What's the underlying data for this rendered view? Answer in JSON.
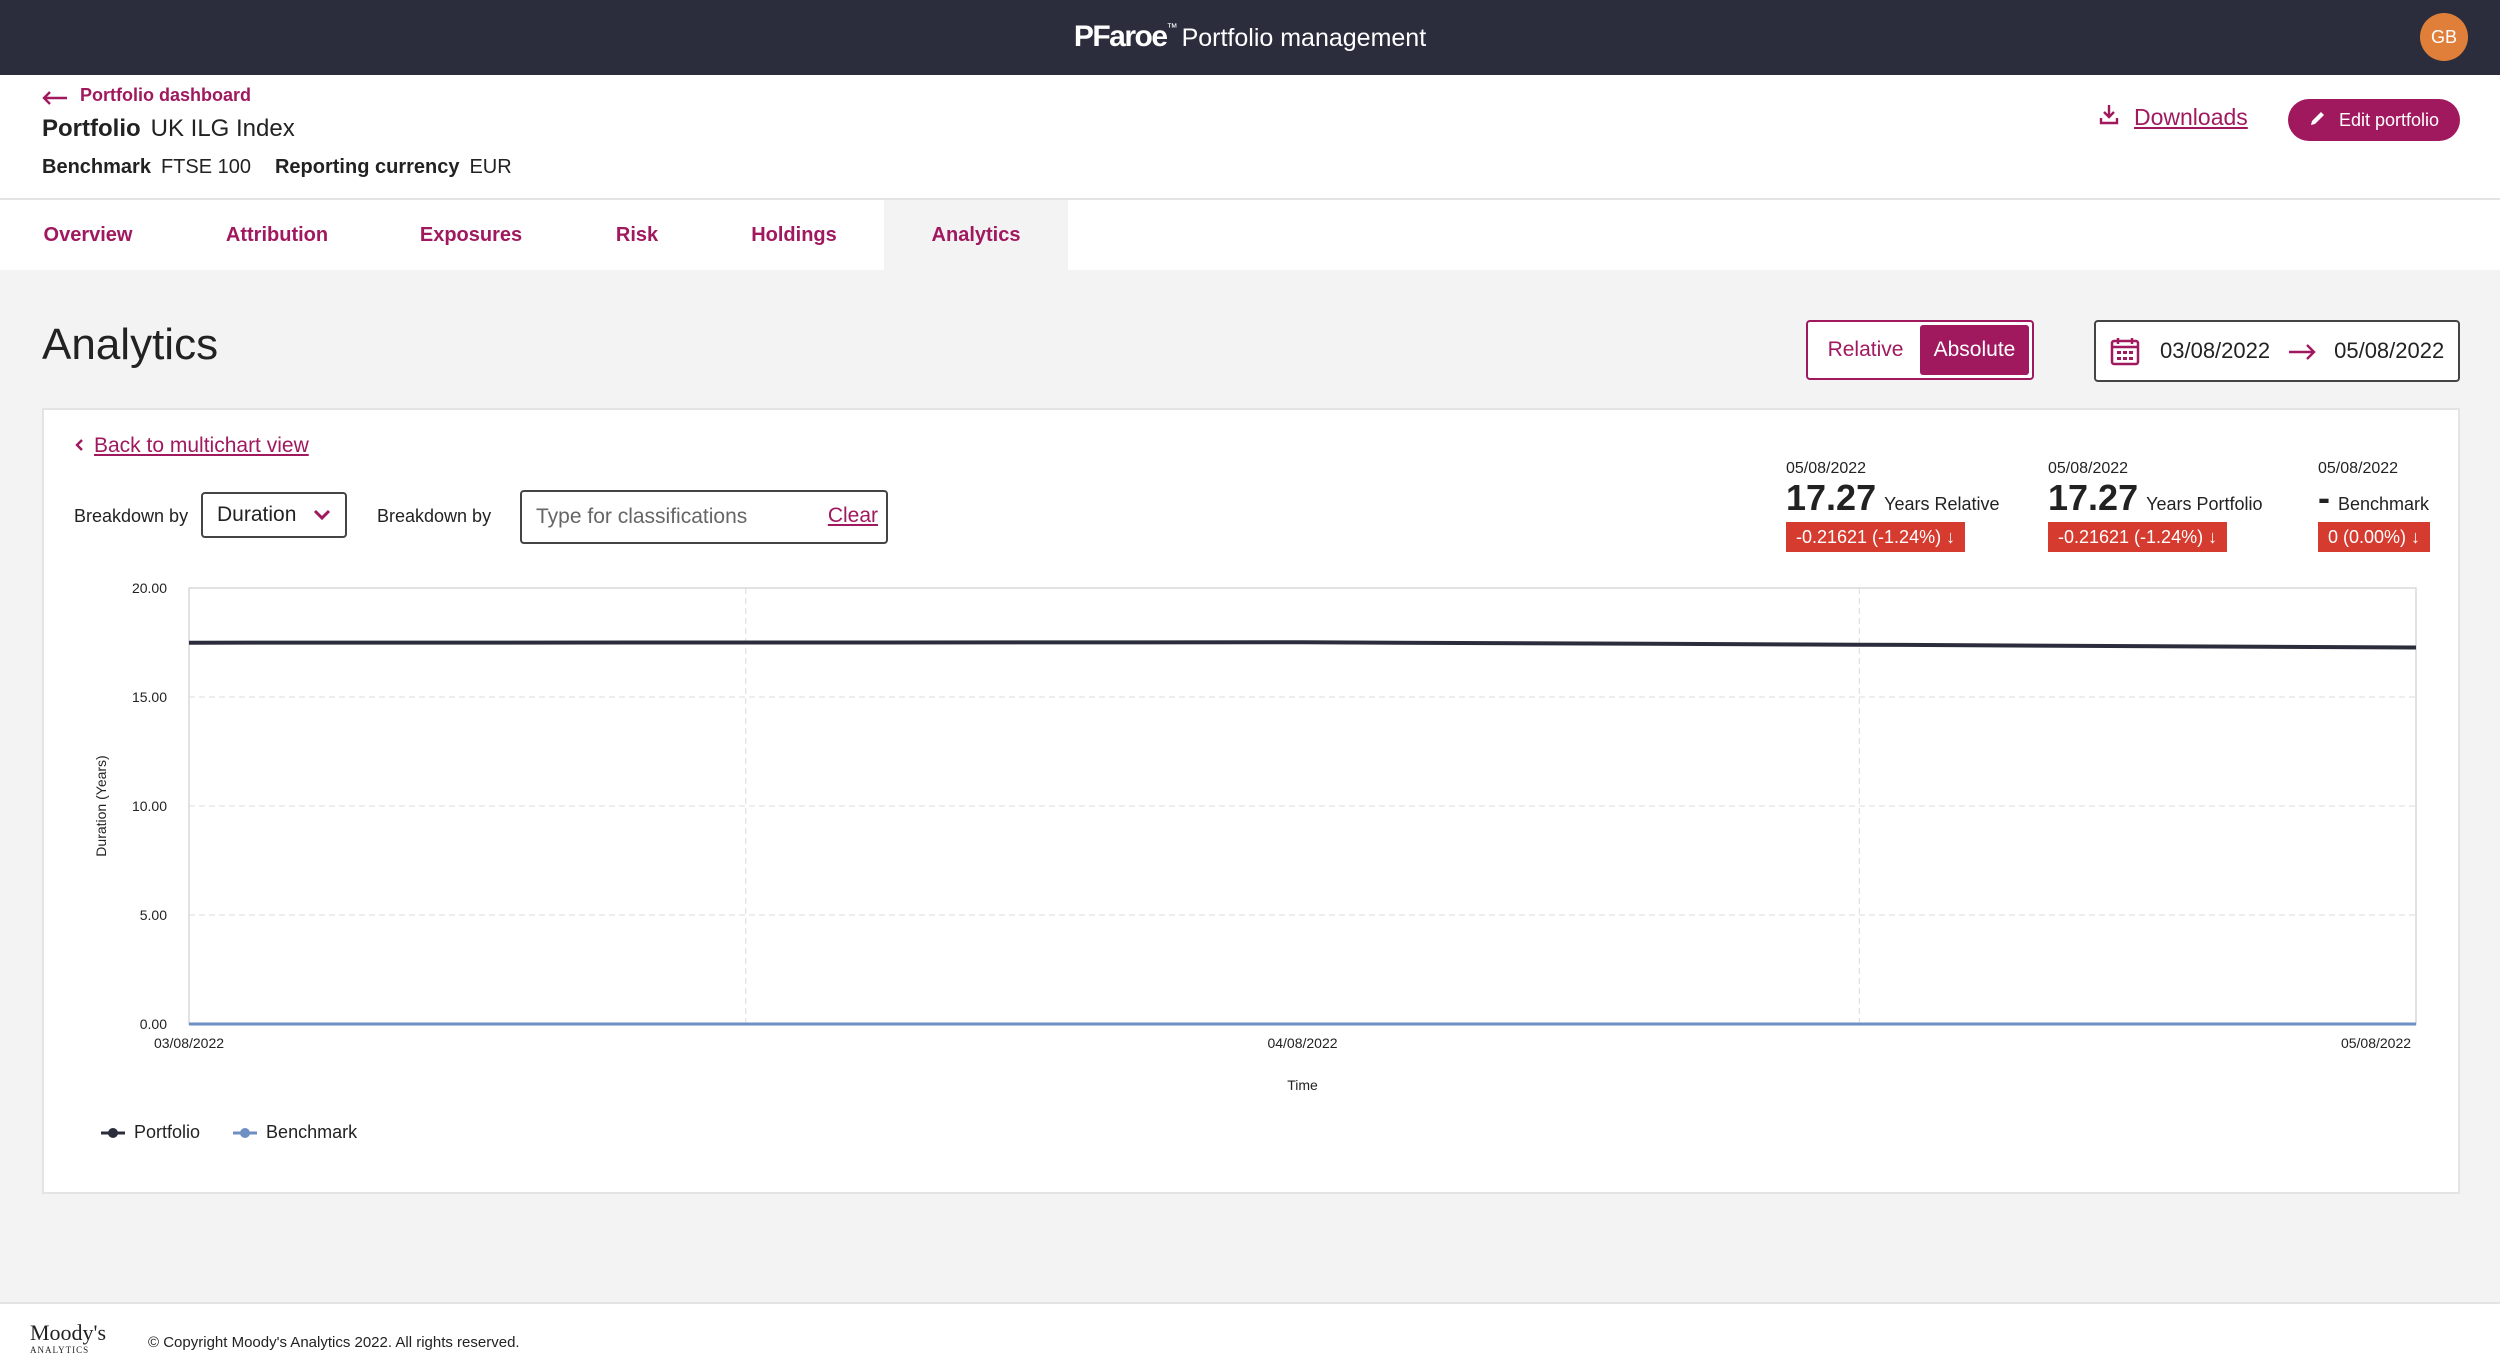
{
  "topbar": {
    "logo": "PFaroe",
    "tm": "™",
    "app_name": "Portfolio management",
    "avatar_initials": "GB",
    "avatar_color": "#e07f3a"
  },
  "header": {
    "back_link": "Portfolio dashboard",
    "portfolio_label": "Portfolio",
    "portfolio_value": "UK ILG Index",
    "benchmark_label": "Benchmark",
    "benchmark_value": "FTSE 100",
    "currency_label": "Reporting currency",
    "currency_value": "EUR",
    "downloads_label": "Downloads",
    "edit_label": "Edit portfolio"
  },
  "tabs": [
    {
      "label": "Overview",
      "active": false
    },
    {
      "label": "Attribution",
      "active": false
    },
    {
      "label": "Exposures",
      "active": false
    },
    {
      "label": "Risk",
      "active": false
    },
    {
      "label": "Holdings",
      "active": false
    },
    {
      "label": "Analytics",
      "active": true
    }
  ],
  "page": {
    "title": "Analytics",
    "toggle": {
      "options": [
        "Relative",
        "Absolute"
      ],
      "selected": "Absolute"
    },
    "date_range": {
      "start": "03/08/2022",
      "end": "05/08/2022"
    }
  },
  "card": {
    "back_link": "Back to multichart view",
    "breakdown_label_1": "Breakdown by",
    "breakdown_value": "Duration",
    "breakdown_label_2": "Breakdown by",
    "classification_placeholder": "Type for classifications",
    "clear_label": "Clear"
  },
  "stats": [
    {
      "date": "05/08/2022",
      "value": "17.27",
      "unit": "Years Relative",
      "change": "-0.21621 (-1.24%) ↓"
    },
    {
      "date": "05/08/2022",
      "value": "17.27",
      "unit": "Years Portfolio",
      "change": "-0.21621 (-1.24%) ↓"
    },
    {
      "date": "05/08/2022",
      "value": "-",
      "unit": "Benchmark",
      "change": "0 (0.00%) ↓"
    }
  ],
  "colors": {
    "accent": "#a0195f",
    "negative": "#d63b2f",
    "portfolio_line": "#2b2d3c",
    "benchmark_line": "#6f8fc4"
  },
  "chart_data": {
    "type": "line",
    "xlabel": "Time",
    "ylabel": "Duration (Years)",
    "ylim": [
      0,
      20
    ],
    "y_ticks": [
      "0.00",
      "5.00",
      "10.00",
      "15.00",
      "20.00"
    ],
    "x_ticks": [
      "03/08/2022",
      "04/08/2022",
      "05/08/2022"
    ],
    "grid": true,
    "legend_position": "bottom-left",
    "series": [
      {
        "name": "Portfolio",
        "x": [
          "03/08/2022",
          "03/08/2022 12:00",
          "04/08/2022",
          "04/08/2022 12:00",
          "05/08/2022"
        ],
        "values": [
          17.49,
          17.5,
          17.51,
          17.4,
          17.27
        ]
      },
      {
        "name": "Benchmark",
        "x": [
          "03/08/2022",
          "05/08/2022"
        ],
        "values": [
          0,
          0
        ]
      }
    ]
  },
  "footer": {
    "brand_line1": "Moody's",
    "brand_line2": "ANALYTICS",
    "copyright": "© Copyright Moody's Analytics 2022. All rights reserved."
  }
}
